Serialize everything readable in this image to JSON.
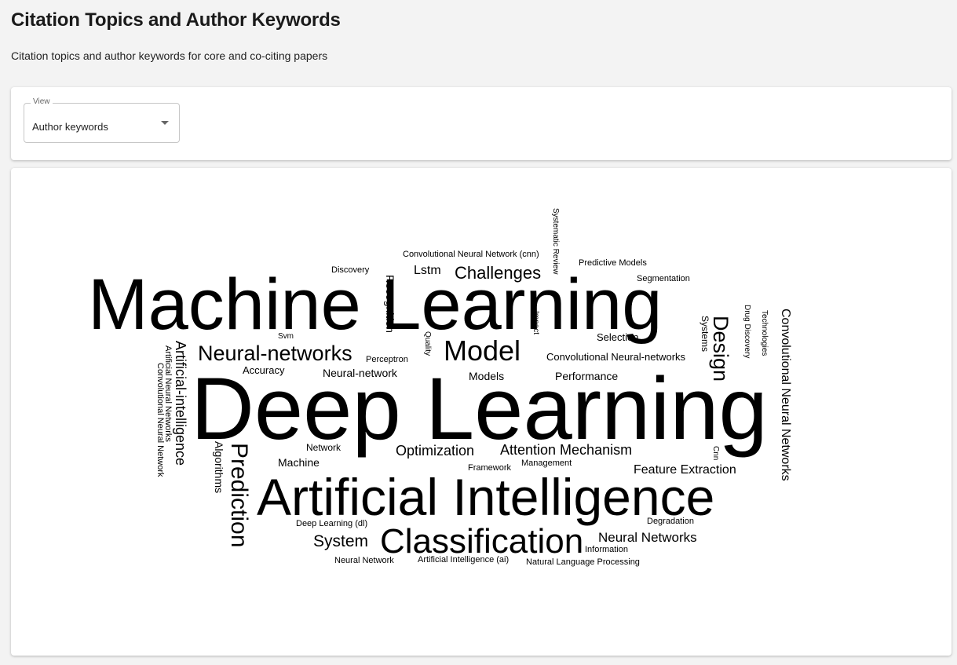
{
  "header": {
    "title": "Citation Topics and Author Keywords",
    "subtitle": "Citation topics and author keywords for core and co-citing papers"
  },
  "filter": {
    "view_label": "View",
    "view_value": "Author keywords"
  },
  "wordcloud": {
    "words": [
      {
        "text": "Machine Learning"
      },
      {
        "text": "Deep Learning"
      },
      {
        "text": "Artificial Intelligence"
      },
      {
        "text": "Classification"
      },
      {
        "text": "Model"
      },
      {
        "text": "Neural-networks"
      },
      {
        "text": "Challenges"
      },
      {
        "text": "Prediction"
      },
      {
        "text": "Design"
      },
      {
        "text": "Artificial-intelligence"
      },
      {
        "text": "Optimization"
      },
      {
        "text": "Attention Mechanism"
      },
      {
        "text": "System"
      },
      {
        "text": "Feature Extraction"
      },
      {
        "text": "Neural Networks"
      },
      {
        "text": "Convolutional Neural Networks"
      },
      {
        "text": "Lstm"
      },
      {
        "text": "Recognition"
      },
      {
        "text": "Algorithms"
      },
      {
        "text": "Machine"
      },
      {
        "text": "Performance"
      },
      {
        "text": "Models"
      },
      {
        "text": "Neural-network"
      },
      {
        "text": "Convolutional Neural-networks"
      },
      {
        "text": "Selection"
      },
      {
        "text": "Accuracy"
      },
      {
        "text": "Systems"
      },
      {
        "text": "Convolutional Neural Network (cnn)"
      },
      {
        "text": "Predictive Models"
      },
      {
        "text": "Segmentation"
      },
      {
        "text": "Discovery"
      },
      {
        "text": "Network"
      },
      {
        "text": "Perceptron"
      },
      {
        "text": "Artificial Neural Networks"
      },
      {
        "text": "Convolutional Neural Network"
      },
      {
        "text": "Systematic Review"
      },
      {
        "text": "Drug Discovery"
      },
      {
        "text": "Technologies"
      },
      {
        "text": "Impact"
      },
      {
        "text": "Quality"
      },
      {
        "text": "Svm"
      },
      {
        "text": "Cnn"
      },
      {
        "text": "Framework"
      },
      {
        "text": "Management"
      },
      {
        "text": "Degradation"
      },
      {
        "text": "Deep Learning (dl)"
      },
      {
        "text": "Information"
      },
      {
        "text": "Neural Network"
      },
      {
        "text": "Artificial Intelligence (ai)"
      },
      {
        "text": "Natural Language Processing"
      }
    ]
  }
}
